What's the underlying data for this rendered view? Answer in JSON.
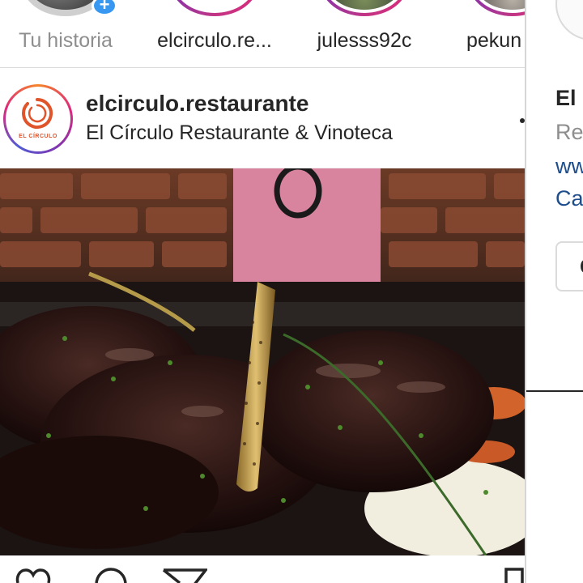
{
  "stories": [
    {
      "label": "Tu historia",
      "is_own": true
    },
    {
      "label": "elcirculo.re..."
    },
    {
      "label": "julesss92c"
    },
    {
      "label": "pekun"
    }
  ],
  "post": {
    "username": "elcirculo.restaurante",
    "location": "El Círculo Restaurante & Vinoteca",
    "avatar_logo_text": "EL CÍRCULO",
    "brand_color": "#e0542b"
  },
  "side_panel": {
    "name": "El",
    "category": "Re",
    "link": "ww",
    "address": "Ca",
    "button_label": "C"
  },
  "colors": {
    "story_ring": "#dd2a7b",
    "add_badge": "#3897f0",
    "link_blue": "#1e4d8c",
    "muted_text": "#8e8e8e"
  },
  "icons": {
    "add_story": "plus-icon",
    "more": "more-options-icon",
    "like": "heart-icon",
    "comment": "comment-icon",
    "share": "paper-plane-icon",
    "save": "bookmark-icon"
  }
}
